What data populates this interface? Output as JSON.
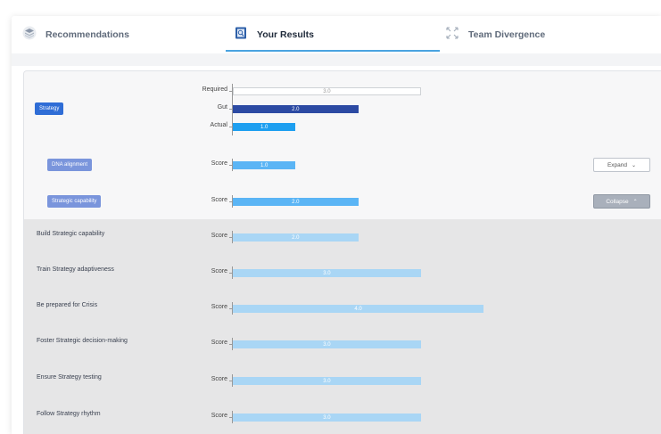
{
  "tabs": [
    {
      "label": "Recommendations",
      "icon": "layers-icon"
    },
    {
      "label": "Your Results",
      "icon": "report-icon"
    },
    {
      "label": "Team Divergence",
      "icon": "expand-arrows-icon"
    }
  ],
  "active_tab": "Your Results",
  "axis_max": 6.0,
  "strategy": {
    "label": "Strategy",
    "rows": [
      {
        "name": "Required",
        "value": 3.0,
        "text": "3.0"
      },
      {
        "name": "Gut",
        "value": 2.0,
        "text": "2.0"
      },
      {
        "name": "Actual",
        "value": 1.0,
        "text": "1.0"
      }
    ]
  },
  "dna": {
    "label": "DNA alignment",
    "score_label": "Score",
    "value": 1.0,
    "text": "1.0",
    "button": "Expand"
  },
  "capability": {
    "label": "Strategic capability",
    "score_label": "Score",
    "value": 2.0,
    "text": "2.0",
    "button": "Collapse"
  },
  "sub_items": [
    {
      "label": "Build Strategic capability",
      "score_label": "Score",
      "value": 2.0,
      "text": "2.0"
    },
    {
      "label": "Train Strategy adaptiveness",
      "score_label": "Score",
      "value": 3.0,
      "text": "3.0"
    },
    {
      "label": "Be prepared for Crisis",
      "score_label": "Score",
      "value": 4.0,
      "text": "4.0"
    },
    {
      "label": "Foster Strategic decision-making",
      "score_label": "Score",
      "value": 3.0,
      "text": "3.0"
    },
    {
      "label": "Ensure Strategy testing",
      "score_label": "Score",
      "value": 3.0,
      "text": "3.0"
    },
    {
      "label": "Follow Strategy rhythm",
      "score_label": "Score",
      "value": 3.0,
      "text": "3.0"
    }
  ]
}
